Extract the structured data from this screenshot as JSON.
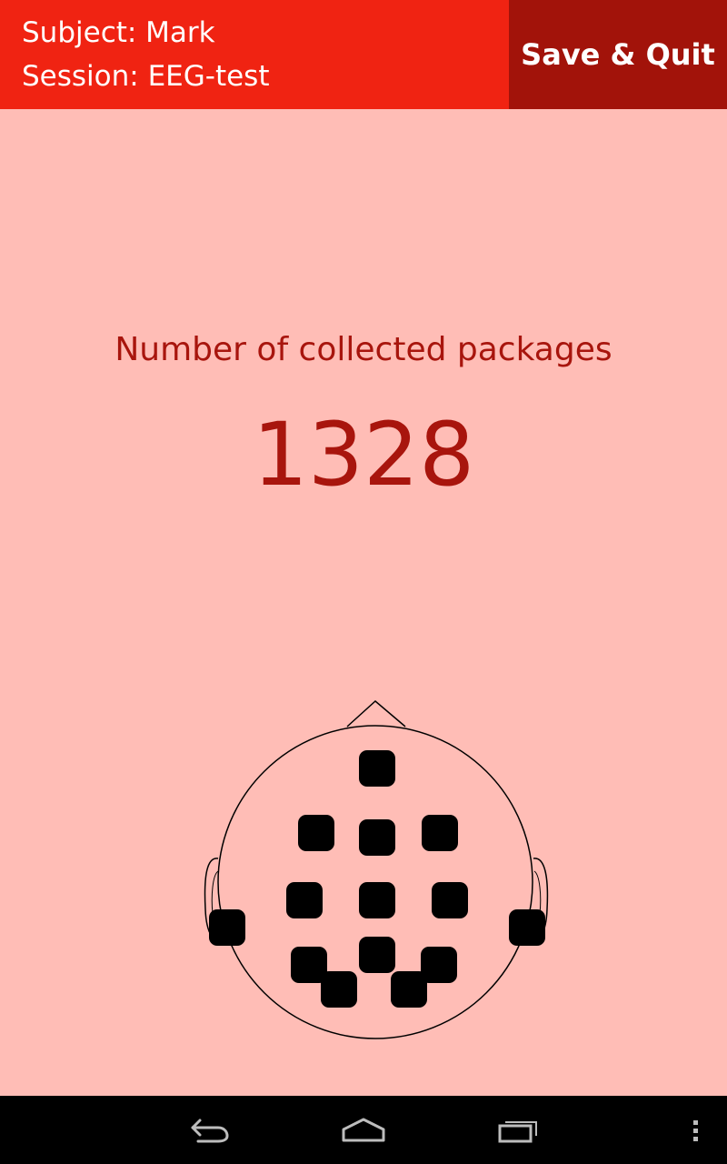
{
  "header": {
    "subject": "Subject: Mark",
    "session": "Session: EEG-test",
    "save_label": "Save & Quit"
  },
  "main": {
    "packets_label": "Number of collected packages",
    "packets_count": "1328"
  },
  "colors": {
    "background": "#ffbdb6",
    "header_bar": "#f02312",
    "save_button": "#a2130a",
    "accent_text": "#a8150d",
    "electrode": "#000000"
  },
  "navbar": {
    "icons": [
      "back-icon",
      "home-icon",
      "recent-apps-icon",
      "overflow-menu-icon"
    ]
  }
}
